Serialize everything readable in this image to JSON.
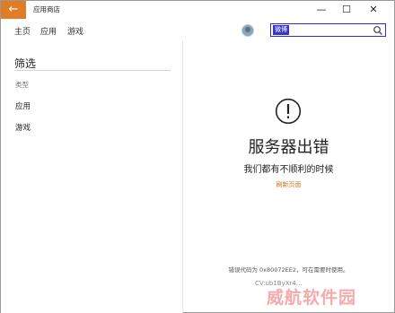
{
  "window": {
    "app_title": "应用商店",
    "back_icon": "←",
    "minimize": "—",
    "maximize": "☐",
    "close": "✕"
  },
  "nav": {
    "items": [
      "主页",
      "应用",
      "游戏"
    ]
  },
  "search": {
    "value": "微博"
  },
  "filter": {
    "title": "筛选",
    "category_label": "类型",
    "items": [
      "应用",
      "游戏"
    ]
  },
  "error": {
    "title": "服务器出错",
    "subtitle": "我们都有不顺利的时候",
    "refresh": "刷新页面",
    "code_text": "错误代码为 0x80072EE2，可在需要时使用。",
    "cv": "CV:ub1ByXr4..."
  },
  "watermark": "威航软件园",
  "colors": {
    "accent": "#e07b26",
    "search_highlight": "#3a36c9",
    "link": "#d0771e"
  }
}
